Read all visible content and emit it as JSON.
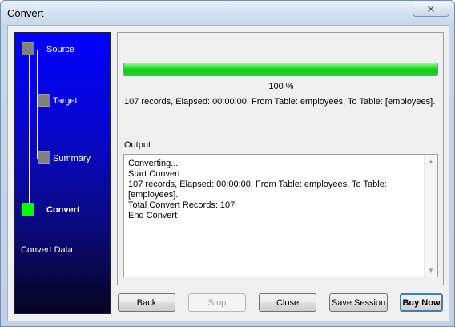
{
  "window": {
    "title": "Convert",
    "close_label": "✕"
  },
  "wizard": {
    "steps": [
      {
        "label": "Source",
        "state": "done"
      },
      {
        "label": "Target",
        "state": "done"
      },
      {
        "label": "Summary",
        "state": "done"
      },
      {
        "label": "Convert",
        "state": "active"
      }
    ],
    "section_title": "Convert Data"
  },
  "progress": {
    "value_percent": 100,
    "label": "100 %"
  },
  "status": "107 records,    Elapsed: 00:00:00.    From Table: employees,    To Table: [employees].",
  "output": {
    "label": "Output",
    "text": "Converting...\nStart Convert\n107 records,    Elapsed: 00:00:00.    From Table: employees,    To Table: [employees].\nTotal Convert Records: 107\nEnd Convert"
  },
  "buttons": {
    "back": "Back",
    "stop": "Stop",
    "close": "Close",
    "save_session": "Save Session",
    "buy_now": "Buy Now"
  },
  "colors": {
    "progress_fill": "#12c912",
    "wizard_top": "#0000ff",
    "wizard_bottom": "#050520",
    "active_step": "#00ff00"
  }
}
